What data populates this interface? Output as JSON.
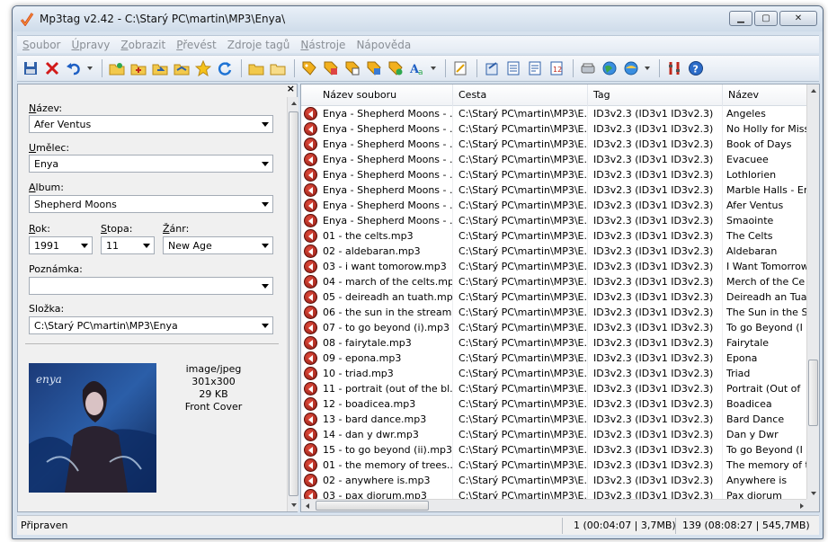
{
  "window": {
    "title": "Mp3tag v2.42  -  C:\\Starý PC\\martin\\MP3\\Enya\\",
    "minimize_glyph": "▁",
    "maximize_glyph": "▢",
    "close_glyph": "✕"
  },
  "menu": [
    {
      "accel": "S",
      "rest": "oubor"
    },
    {
      "accel": "Ú",
      "rest": "pravy"
    },
    {
      "accel": "Z",
      "rest": "obrazit"
    },
    {
      "accel": "P",
      "rest": "řevést"
    },
    {
      "accel": "",
      "rest": "Zdroje tagů"
    },
    {
      "accel": "N",
      "rest": "ástroje"
    },
    {
      "accel": "",
      "rest": "Nápověda"
    }
  ],
  "toolbar_icons": [
    "save-icon",
    "remove-tag-icon",
    "undo-icon",
    "open-folder-icon",
    "add-folder-icon",
    "change-dir-icon",
    "favorite-icon",
    "refresh-icon",
    "tag-filename-icon",
    "filename-tag-icon",
    "text-file-icon",
    "auto-numbering-icon",
    "actions-icon",
    "export-icon",
    "playlist-icon",
    "tag-sources-icon",
    "settings-icon",
    "help-icon"
  ],
  "left_panel": {
    "close_glyph": "×",
    "title": {
      "label_accel": "N",
      "label_rest": "ázev:",
      "value": "Afer Ventus"
    },
    "artist": {
      "label_accel": "U",
      "label_rest": "mělec:",
      "value": "Enya"
    },
    "album": {
      "label_accel": "A",
      "label_rest": "lbum:",
      "value": "Shepherd Moons"
    },
    "year": {
      "label_accel": "R",
      "label_rest": "ok:",
      "value": "1991"
    },
    "track": {
      "label_accel": "S",
      "label_rest": "topa:",
      "value": "11"
    },
    "genre": {
      "label_accel": "Ž",
      "label_rest": "ánr:",
      "value": "New Age"
    },
    "comment": {
      "label_accel": "",
      "label_rest": "Poznámka:",
      "value": ""
    },
    "folder": {
      "label_accel": "",
      "label_rest": "Složka:",
      "value": "C:\\Starý PC\\martin\\MP3\\Enya"
    },
    "cover": {
      "mime": "image/jpeg",
      "dimensions": "301x300",
      "size": "29 KB",
      "type": "Front Cover",
      "art_text": "enya"
    }
  },
  "file_list": {
    "columns": [
      "Název souboru",
      "Cesta",
      "Tag",
      "Název"
    ],
    "rows": [
      [
        "Enya - Shepherd Moons - ...",
        "C:\\Starý PC\\martin\\MP3\\E...",
        "ID3v2.3 (ID3v1 ID3v2.3)",
        "Angeles"
      ],
      [
        "Enya - Shepherd Moons - ...",
        "C:\\Starý PC\\martin\\MP3\\E...",
        "ID3v2.3 (ID3v1 ID3v2.3)",
        "No Holly for Miss"
      ],
      [
        "Enya - Shepherd Moons - ...",
        "C:\\Starý PC\\martin\\MP3\\E...",
        "ID3v2.3 (ID3v1 ID3v2.3)",
        "Book of Days"
      ],
      [
        "Enya - Shepherd Moons - ...",
        "C:\\Starý PC\\martin\\MP3\\E...",
        "ID3v2.3 (ID3v1 ID3v2.3)",
        "Evacuee"
      ],
      [
        "Enya - Shepherd Moons - ...",
        "C:\\Starý PC\\martin\\MP3\\E...",
        "ID3v2.3 (ID3v1 ID3v2.3)",
        "Lothlorien"
      ],
      [
        "Enya - Shepherd Moons - ...",
        "C:\\Starý PC\\martin\\MP3\\E...",
        "ID3v2.3 (ID3v1 ID3v2.3)",
        "Marble Halls - Er"
      ],
      [
        "Enya - Shepherd Moons - ...",
        "C:\\Starý PC\\martin\\MP3\\E...",
        "ID3v2.3 (ID3v1 ID3v2.3)",
        "Afer Ventus"
      ],
      [
        "Enya - Shepherd Moons - ...",
        "C:\\Starý PC\\martin\\MP3\\E...",
        "ID3v2.3 (ID3v1 ID3v2.3)",
        "Smaointe"
      ],
      [
        "01 - the celts.mp3",
        "C:\\Starý PC\\martin\\MP3\\E...",
        "ID3v2.3 (ID3v1 ID3v2.3)",
        "The Celts"
      ],
      [
        "02 - aldebaran.mp3",
        "C:\\Starý PC\\martin\\MP3\\E...",
        "ID3v2.3 (ID3v1 ID3v2.3)",
        "Aldebaran"
      ],
      [
        "03 - i want tomorow.mp3",
        "C:\\Starý PC\\martin\\MP3\\E...",
        "ID3v2.3 (ID3v1 ID3v2.3)",
        "I Want Tomorrow"
      ],
      [
        "04 - march of the celts.mp3",
        "C:\\Starý PC\\martin\\MP3\\E...",
        "ID3v2.3 (ID3v1 ID3v2.3)",
        "Merch of the Ce"
      ],
      [
        "05 - deireadh an tuath.mp3",
        "C:\\Starý PC\\martin\\MP3\\E...",
        "ID3v2.3 (ID3v1 ID3v2.3)",
        "Deireadh an Tua"
      ],
      [
        "06 - the sun in the stream....",
        "C:\\Starý PC\\martin\\MP3\\E...",
        "ID3v2.3 (ID3v1 ID3v2.3)",
        "The Sun in the S"
      ],
      [
        "07 - to go beyond (i).mp3",
        "C:\\Starý PC\\martin\\MP3\\E...",
        "ID3v2.3 (ID3v1 ID3v2.3)",
        "To go Beyond (I"
      ],
      [
        "08 - fairytale.mp3",
        "C:\\Starý PC\\martin\\MP3\\E...",
        "ID3v2.3 (ID3v1 ID3v2.3)",
        "Fairytale"
      ],
      [
        "09 - epona.mp3",
        "C:\\Starý PC\\martin\\MP3\\E...",
        "ID3v2.3 (ID3v1 ID3v2.3)",
        "Epona"
      ],
      [
        "10 - triad.mp3",
        "C:\\Starý PC\\martin\\MP3\\E...",
        "ID3v2.3 (ID3v1 ID3v2.3)",
        "Triad"
      ],
      [
        "11 - portrait (out of the bl...",
        "C:\\Starý PC\\martin\\MP3\\E...",
        "ID3v2.3 (ID3v1 ID3v2.3)",
        "Portrait (Out of"
      ],
      [
        "12 - boadicea.mp3",
        "C:\\Starý PC\\martin\\MP3\\E...",
        "ID3v2.3 (ID3v1 ID3v2.3)",
        "Boadicea"
      ],
      [
        "13 - bard dance.mp3",
        "C:\\Starý PC\\martin\\MP3\\E...",
        "ID3v2.3 (ID3v1 ID3v2.3)",
        "Bard Dance"
      ],
      [
        "14 - dan y dwr.mp3",
        "C:\\Starý PC\\martin\\MP3\\E...",
        "ID3v2.3 (ID3v1 ID3v2.3)",
        "Dan y Dwr"
      ],
      [
        "15 - to go beyond (ii).mp3",
        "C:\\Starý PC\\martin\\MP3\\E...",
        "ID3v2.3 (ID3v1 ID3v2.3)",
        "To go Beyond (I"
      ],
      [
        "01 - the memory of trees....",
        "C:\\Starý PC\\martin\\MP3\\E...",
        "ID3v2.3 (ID3v1 ID3v2.3)",
        "The memory of t"
      ],
      [
        "02 - anywhere is.mp3",
        "C:\\Starý PC\\martin\\MP3\\E...",
        "ID3v2.3 (ID3v1 ID3v2.3)",
        "Anywhere is"
      ],
      [
        "03 - pax diorum.mp3",
        "C:\\Starý PC\\martin\\MP3\\E...",
        "ID3v2.3 (ID3v1 ID3v2.3)",
        "Pax diorum"
      ]
    ]
  },
  "status": {
    "state": "Připraven",
    "selected": "1 (00:04:07 | 3,7MB)",
    "total": "139 (08:08:27 | 545,7MB)"
  },
  "colors": {
    "frame": "#d7e2ee",
    "play_icon": "#c0281c",
    "menu_text": "#8a8f96"
  }
}
